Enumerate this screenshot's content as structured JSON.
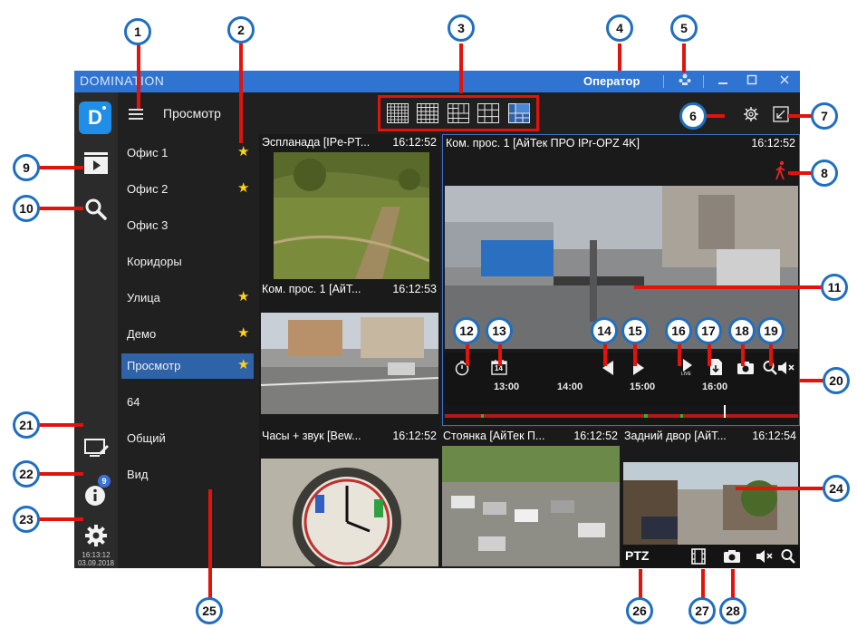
{
  "window": {
    "app_title": "DOMINATION",
    "operator_label": "Оператор"
  },
  "rail": {
    "logo_letter": "D",
    "time": "16:13:12",
    "date": "03.09.2018",
    "info_badge": "9"
  },
  "panel": {
    "title": "Просмотр",
    "items": [
      {
        "label": "Офис 1",
        "starred": true
      },
      {
        "label": "Офис 2",
        "starred": true
      },
      {
        "label": "Офис 3",
        "starred": false
      },
      {
        "label": "Коридоры",
        "starred": false
      },
      {
        "label": "Улица",
        "starred": true
      },
      {
        "label": "Демо",
        "starred": true
      },
      {
        "label": "Просмотр",
        "starred": true,
        "active": true
      },
      {
        "label": "64",
        "starred": false
      },
      {
        "label": "Общий",
        "starred": false
      },
      {
        "label": "Вид",
        "starred": false
      }
    ]
  },
  "cameras": {
    "cam1": {
      "title": "Эспланада [IPe-PT...",
      "time": "16:12:52"
    },
    "cam2": {
      "title": "Ком. прос. 1 [АйТ...",
      "time": "16:12:53"
    },
    "main": {
      "title": "Ком. прос. 1 [АйТек ПРО IPr-OPZ 4K]",
      "time": "16:12:52"
    },
    "cam4": {
      "title": "Часы + звук [Bew...",
      "time": "16:12:52"
    },
    "cam5": {
      "title": "Стоянка [АйТек П...",
      "time": "16:12:52"
    },
    "cam6": {
      "title": "Задний двор [АйТ...",
      "time": "16:12:54"
    }
  },
  "timeline": {
    "date_icon_label": "14",
    "live_label": "LIVE",
    "ticks": [
      "13:00",
      "14:00",
      "15:00",
      "16:00"
    ]
  },
  "bottom_bar": {
    "ptz_label": "PTZ"
  },
  "markers": [
    "1",
    "2",
    "3",
    "4",
    "5",
    "6",
    "7",
    "8",
    "9",
    "10",
    "11",
    "12",
    "13",
    "14",
    "15",
    "16",
    "17",
    "18",
    "19",
    "20",
    "21",
    "22",
    "23",
    "24",
    "25",
    "26",
    "27",
    "28"
  ],
  "colors": {
    "titlebar": "#2f74d0",
    "active_item": "#2f63a8",
    "star": "#ffd21a",
    "marker_border": "#1f6fc0",
    "arrow": "#e3120b",
    "logo": "#1e8ee8"
  }
}
